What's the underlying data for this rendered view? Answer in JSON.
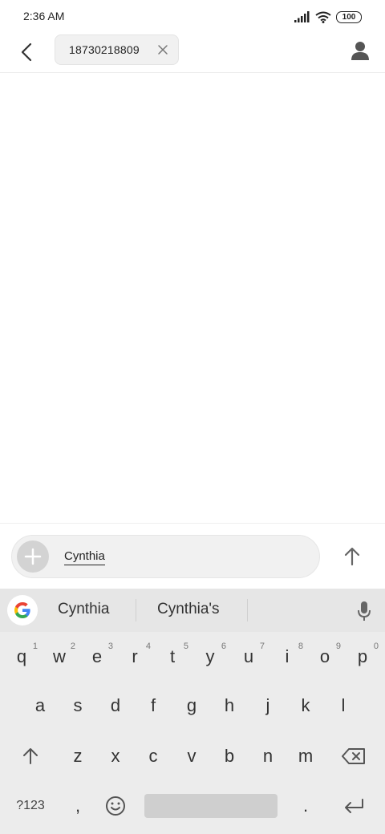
{
  "status_bar": {
    "time": "2:36 AM",
    "battery": "100"
  },
  "header": {
    "recipient": "18730218809"
  },
  "compose": {
    "text": "Cynthia"
  },
  "keyboard": {
    "suggestions": [
      "Cynthia",
      "Cynthia's"
    ],
    "row1": [
      {
        "key": "q",
        "hint": "1"
      },
      {
        "key": "w",
        "hint": "2"
      },
      {
        "key": "e",
        "hint": "3"
      },
      {
        "key": "r",
        "hint": "4"
      },
      {
        "key": "t",
        "hint": "5"
      },
      {
        "key": "y",
        "hint": "6"
      },
      {
        "key": "u",
        "hint": "7"
      },
      {
        "key": "i",
        "hint": "8"
      },
      {
        "key": "o",
        "hint": "9"
      },
      {
        "key": "p",
        "hint": "0"
      }
    ],
    "row2": [
      "a",
      "s",
      "d",
      "f",
      "g",
      "h",
      "j",
      "k",
      "l"
    ],
    "row3": [
      "z",
      "x",
      "c",
      "v",
      "b",
      "n",
      "m"
    ],
    "mode_key": "?123",
    "comma_key": ",",
    "period_key": "."
  }
}
